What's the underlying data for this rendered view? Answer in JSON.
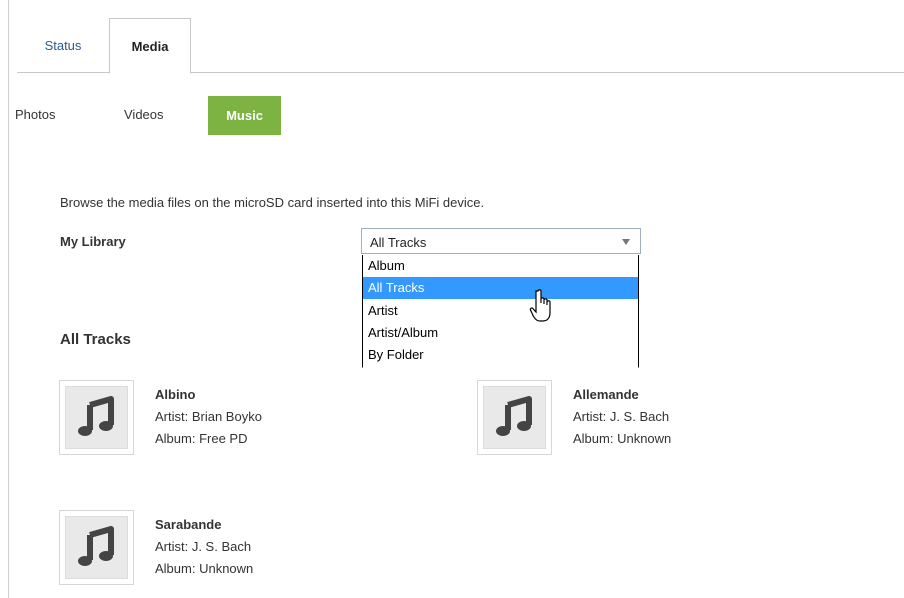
{
  "tabs": {
    "status": "Status",
    "media": "Media"
  },
  "subtabs": {
    "photos": "Photos",
    "videos": "Videos",
    "music": "Music"
  },
  "intro_text": "Browse the media files on the microSD card inserted into this MiFi device.",
  "library": {
    "label": "My Library",
    "selected": "All Tracks",
    "options": [
      "Album",
      "All Tracks",
      "Artist",
      "Artist/Album",
      "By Folder"
    ]
  },
  "section_title": "All Tracks",
  "tracks": [
    {
      "title": "Albino",
      "artist": "Artist: Brian Boyko",
      "album": "Album: Free PD"
    },
    {
      "title": "Allemande",
      "artist": "Artist: J. S. Bach",
      "album": "Album: Unknown"
    },
    {
      "title": "Sarabande",
      "artist": "Artist: J. S. Bach",
      "album": "Album: Unknown"
    }
  ],
  "colors": {
    "active_subtab": "#7cb342",
    "highlight": "#3399ff",
    "link": "#2a5a8a"
  },
  "icons": {
    "track_thumb": "music-note-icon",
    "cursor": "hand-pointer-icon"
  }
}
